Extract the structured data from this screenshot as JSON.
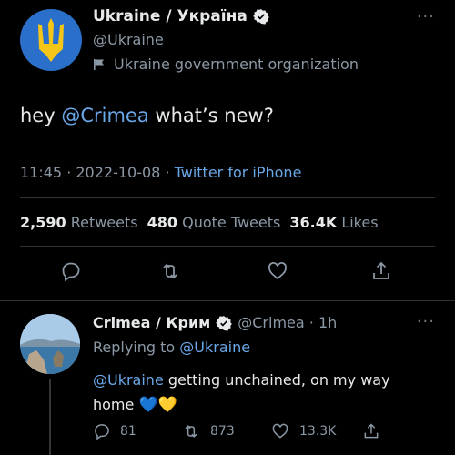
{
  "main_tweet": {
    "display_name": "Ukraine / Україна",
    "handle": "@Ukraine",
    "gov_label": "Ukraine government organization",
    "text_before": "hey ",
    "mention": "@Crimea",
    "text_after": " what’s new?",
    "time": "11:45 · 2022-10-08 · ",
    "source": "Twitter for iPhone",
    "stats": {
      "retweets_count": "2,590",
      "retweets_label": "Retweets",
      "quotes_count": "480",
      "quotes_label": "Quote Tweets",
      "likes_count": "36.4K",
      "likes_label": "Likes"
    },
    "more": "···"
  },
  "reply": {
    "display_name": "Crimea / Крим",
    "handle_time": "@Crimea · 1h",
    "replying_prefix": "Replying to ",
    "replying_mention": "@Ukraine",
    "text_mention": "@Ukraine",
    "text_body": " getting unchained, on my way home ",
    "heart_blue": "💙",
    "heart_yellow": "💛",
    "replies": "81",
    "retweets": "873",
    "likes": "13.3K",
    "more": "···"
  },
  "icons": [
    "verified-badge-icon",
    "government-flag-icon",
    "reply-icon",
    "retweet-icon",
    "like-icon",
    "share-icon",
    "more-icon"
  ],
  "colors": {
    "accent": "#6aa7e7",
    "muted": "#8b98a5",
    "background": "#000000",
    "verified": "#e7e9ea"
  }
}
